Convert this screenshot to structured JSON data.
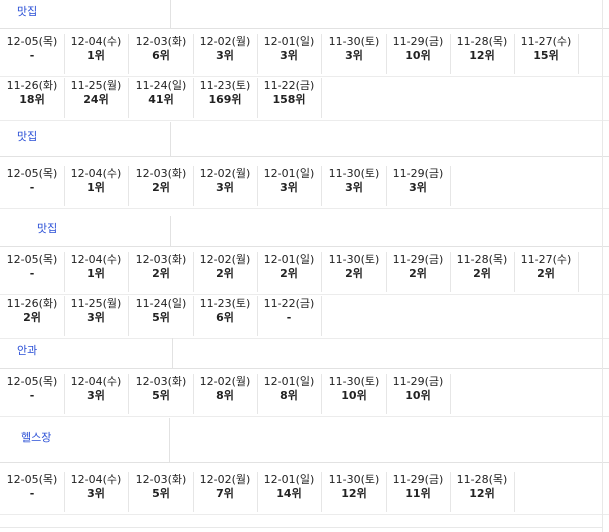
{
  "sections": [
    {
      "keyword": "맛집",
      "rows": [
        [
          {
            "date": "12-05(목)",
            "rank": "-"
          },
          {
            "date": "12-04(수)",
            "rank": "1위"
          },
          {
            "date": "12-03(화)",
            "rank": "6위"
          },
          {
            "date": "12-02(월)",
            "rank": "3위"
          },
          {
            "date": "12-01(일)",
            "rank": "3위"
          },
          {
            "date": "11-30(토)",
            "rank": "3위"
          },
          {
            "date": "11-29(금)",
            "rank": "10위"
          },
          {
            "date": "11-28(목)",
            "rank": "12위"
          },
          {
            "date": "11-27(수)",
            "rank": "15위"
          }
        ],
        [
          {
            "date": "11-26(화)",
            "rank": "18위"
          },
          {
            "date": "11-25(월)",
            "rank": "24위"
          },
          {
            "date": "11-24(일)",
            "rank": "41위"
          },
          {
            "date": "11-23(토)",
            "rank": "169위"
          },
          {
            "date": "11-22(금)",
            "rank": "158위"
          }
        ]
      ]
    },
    {
      "keyword": "맛집",
      "rows": [
        [
          {
            "date": "12-05(목)",
            "rank": "-"
          },
          {
            "date": "12-04(수)",
            "rank": "1위"
          },
          {
            "date": "12-03(화)",
            "rank": "2위"
          },
          {
            "date": "12-02(월)",
            "rank": "3위"
          },
          {
            "date": "12-01(일)",
            "rank": "3위"
          },
          {
            "date": "11-30(토)",
            "rank": "3위"
          },
          {
            "date": "11-29(금)",
            "rank": "3위"
          }
        ]
      ]
    },
    {
      "keyword": "맛집",
      "rows": [
        [
          {
            "date": "12-05(목)",
            "rank": "-"
          },
          {
            "date": "12-04(수)",
            "rank": "1위"
          },
          {
            "date": "12-03(화)",
            "rank": "2위"
          },
          {
            "date": "12-02(월)",
            "rank": "2위"
          },
          {
            "date": "12-01(일)",
            "rank": "2위"
          },
          {
            "date": "11-30(토)",
            "rank": "2위"
          },
          {
            "date": "11-29(금)",
            "rank": "2위"
          },
          {
            "date": "11-28(목)",
            "rank": "2위"
          },
          {
            "date": "11-27(수)",
            "rank": "2위"
          }
        ],
        [
          {
            "date": "11-26(화)",
            "rank": "2위"
          },
          {
            "date": "11-25(월)",
            "rank": "3위"
          },
          {
            "date": "11-24(일)",
            "rank": "5위"
          },
          {
            "date": "11-23(토)",
            "rank": "6위"
          },
          {
            "date": "11-22(금)",
            "rank": "-"
          }
        ]
      ]
    },
    {
      "keyword": "안과",
      "rows": [
        [
          {
            "date": "12-05(목)",
            "rank": "-"
          },
          {
            "date": "12-04(수)",
            "rank": "3위"
          },
          {
            "date": "12-03(화)",
            "rank": "5위"
          },
          {
            "date": "12-02(월)",
            "rank": "8위"
          },
          {
            "date": "12-01(일)",
            "rank": "8위"
          },
          {
            "date": "11-30(토)",
            "rank": "10위"
          },
          {
            "date": "11-29(금)",
            "rank": "10위"
          }
        ]
      ]
    },
    {
      "keyword": "헬스장",
      "rows": [
        [
          {
            "date": "12-05(목)",
            "rank": "-"
          },
          {
            "date": "12-04(수)",
            "rank": "3위"
          },
          {
            "date": "12-03(화)",
            "rank": "5위"
          },
          {
            "date": "12-02(월)",
            "rank": "7위"
          },
          {
            "date": "12-01(일)",
            "rank": "14위"
          },
          {
            "date": "11-30(토)",
            "rank": "12위"
          },
          {
            "date": "11-29(금)",
            "rank": "11위"
          },
          {
            "date": "11-28(목)",
            "rank": "12위"
          }
        ]
      ]
    }
  ],
  "colors": {
    "keyword": "#2a4fd6",
    "border": "#e2e2e2",
    "text": "#222222"
  }
}
